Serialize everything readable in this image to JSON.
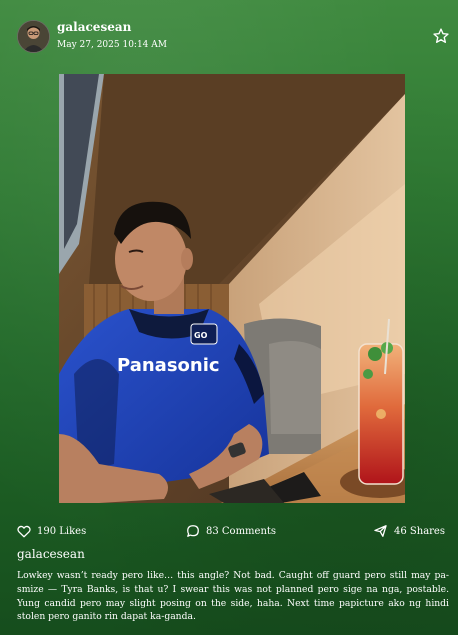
{
  "post": {
    "username": "galacesean",
    "timestamp": "May 27, 2025 10:14 AM",
    "avatar_icon": "profile-photo",
    "favorite_icon": "star-outline-icon"
  },
  "photo": {
    "jersey_text": "Panasonic",
    "description_icon": "photo-of-person-at-cafe-table"
  },
  "stats": {
    "likes": "190 Likes",
    "comments": "83 Comments",
    "shares": "46 Shares"
  },
  "caption": {
    "username": "galacesean",
    "text": "Lowkey wasn’t ready pero like… this angle? Not bad. Caught off guard pero still may pa-smize — Tyra Banks, is that u? I swear this was not planned pero sige na nga, postable. Yung candid pero may slight posing on the side, haha. Next time papicture ako ng hindi stolen pero ganito rin dapat ka-ganda."
  },
  "colors": {
    "background_top": "#3f8a3f",
    "background_bottom": "#164d1d",
    "text": "#ffffff",
    "jersey_blue": "#1f43b8"
  }
}
